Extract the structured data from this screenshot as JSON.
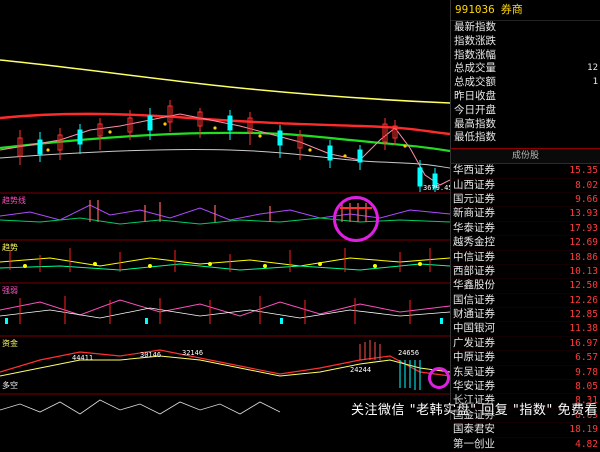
{
  "sidebar": {
    "code": "991036",
    "name": "券商",
    "info": [
      {
        "label": "最新指数",
        "value": ""
      },
      {
        "label": "指数涨跌",
        "value": ""
      },
      {
        "label": "指数涨幅",
        "value": ""
      },
      {
        "label": "总成交量",
        "value": "12"
      },
      {
        "label": "总成交额",
        "value": "1"
      },
      {
        "label": "昨日收盘",
        "value": ""
      },
      {
        "label": "今日开盘",
        "value": ""
      },
      {
        "label": "最高指数",
        "value": ""
      },
      {
        "label": "最低指数",
        "value": ""
      }
    ],
    "list_header": "成份股",
    "stocks": [
      {
        "name": "华西证券",
        "price": "15.35"
      },
      {
        "name": "山西证券",
        "price": "8.02"
      },
      {
        "name": "国元证券",
        "price": "9.66"
      },
      {
        "name": "新商证券",
        "price": "13.93"
      },
      {
        "name": "华泰证券",
        "price": "17.93"
      },
      {
        "name": "越秀金控",
        "price": "12.69"
      },
      {
        "name": "中信证券",
        "price": "18.86"
      },
      {
        "name": "西部证券",
        "price": "10.13"
      },
      {
        "name": "华鑫股份",
        "price": "12.50"
      },
      {
        "name": "国信证券",
        "price": "12.26"
      },
      {
        "name": "财通证券",
        "price": "12.85"
      },
      {
        "name": "中国银河",
        "price": "11.38"
      },
      {
        "name": "广发证券",
        "price": "16.97"
      },
      {
        "name": "中原证券",
        "price": "6.57"
      },
      {
        "name": "东吴证券",
        "price": "9.78"
      },
      {
        "name": "华安证券",
        "price": "8.05"
      },
      {
        "name": "长江证券",
        "price": "8.31"
      },
      {
        "name": "国金证券",
        "price": "8.65"
      },
      {
        "name": "国泰君安",
        "price": "18.19"
      },
      {
        "name": "第一创业",
        "price": "4.82"
      }
    ]
  },
  "chart": {
    "top_label": "3679.45",
    "indicator_labels": [
      "趋势线",
      "趋势",
      "强弱",
      "资金",
      "多空"
    ],
    "volume_labels": [
      "44411",
      "30146",
      "32146",
      "24244",
      "24656"
    ],
    "main_line_color": "#ffff66",
    "ma_red": "#ff2a2a",
    "ma_green": "#22dd22",
    "highlight_color": "#e020e0"
  },
  "watermark": "关注微信 \"老韩实盘\" 回复 \"指数\" 免费看"
}
